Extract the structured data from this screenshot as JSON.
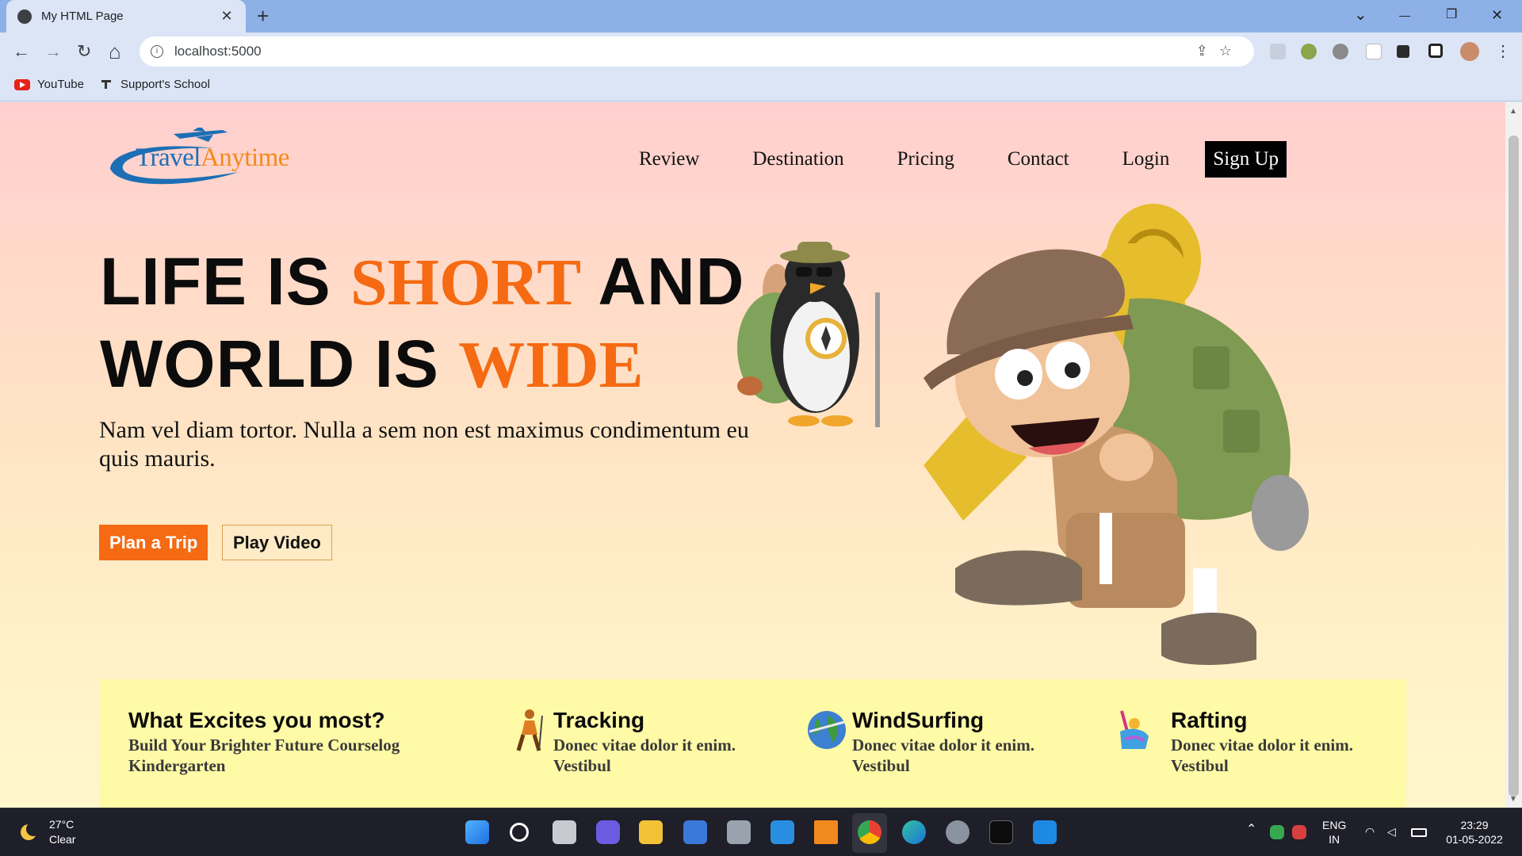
{
  "browser": {
    "tab_title": "My HTML Page",
    "tab_close": "✕",
    "new_tab": "+",
    "url": "localhost:5000",
    "bookmarks": [
      "YouTube",
      "Support's School"
    ],
    "window_controls": {
      "dropdown": "⌄",
      "minimize": "—",
      "restore": "❐",
      "close": "✕"
    },
    "nav": {
      "back": "←",
      "forward": "→",
      "reload": "↻",
      "home": "⌂"
    },
    "omni_actions": "⇪☆"
  },
  "site": {
    "logo": {
      "part1": "Travel",
      "part2": "Anytime"
    },
    "nav": [
      "Review",
      "Destination",
      "Pricing",
      "Contact",
      "Login"
    ],
    "signup": "Sign Up"
  },
  "hero": {
    "line1_a": "LIFE IS ",
    "line1_accent": "SHORT",
    "line1_b": " AND",
    "line2_a": "WORLD IS ",
    "line2_accent": "WIDE",
    "paragraph": "Nam vel diam tortor. Nulla a sem non est maximus condimentum eu quis mauris.",
    "btn_plan": "Plan a Trip",
    "btn_video": "Play Video"
  },
  "features": {
    "intro_title": "What Excites you most?",
    "intro_sub": "Build Your Brighter Future Courselog Kindergarten",
    "items": [
      {
        "title": "Tracking",
        "sub": "Donec vitae dolor it enim. Vestibul"
      },
      {
        "title": "WindSurfing",
        "sub": "Donec vitae dolor it enim. Vestibul"
      },
      {
        "title": "Rafting",
        "sub": "Donec vitae dolor it enim. Vestibul"
      }
    ]
  },
  "taskbar": {
    "temp": "27°C",
    "weather": "Clear",
    "lang1": "ENG",
    "lang2": "IN",
    "time": "23:29",
    "date": "01-05-2022"
  },
  "colors": {
    "accent": "#f56a12",
    "logo_blue": "#1c6fb5",
    "logo_orange": "#f28a1a",
    "feature_bg": "#fffaa6"
  }
}
